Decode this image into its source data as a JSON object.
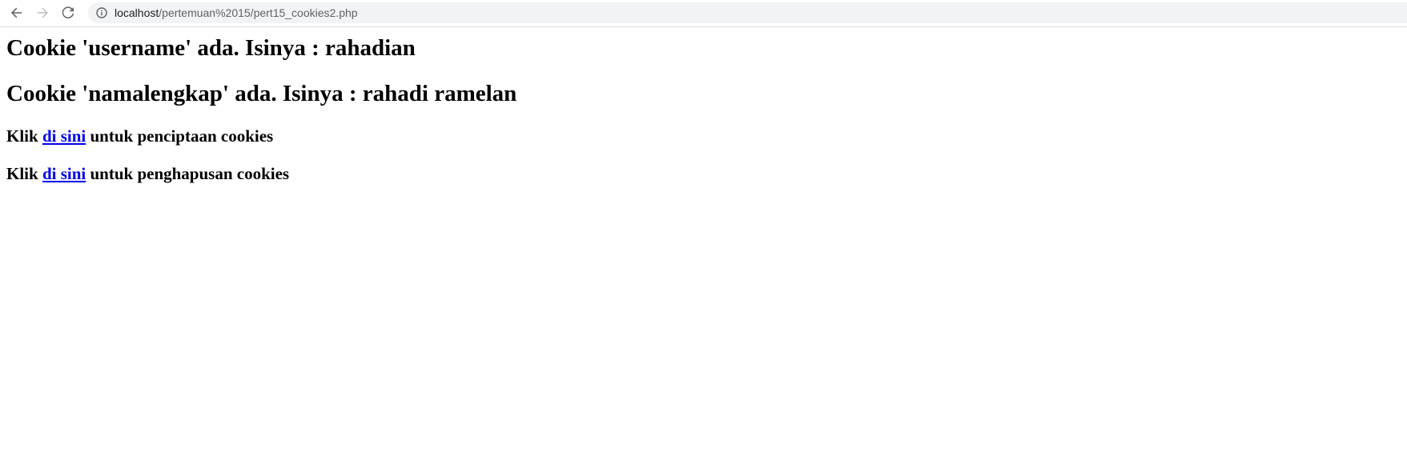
{
  "browser": {
    "url_host": "localhost",
    "url_path": "/pertemuan%2015/pert15_cookies2.php",
    "icons": {
      "back": "back-arrow-icon",
      "forward": "forward-arrow-icon",
      "reload": "reload-icon",
      "info": "info-icon"
    }
  },
  "page": {
    "heading_username": "Cookie 'username' ada. Isinya : rahadian",
    "heading_namalengkap": "Cookie 'namalengkap' ada. Isinya : rahadi ramelan",
    "create_line": {
      "prefix": "Klik ",
      "link_text": "di sini",
      "suffix": " untuk penciptaan cookies"
    },
    "delete_line": {
      "prefix": "Klik ",
      "link_text": "di sini",
      "suffix": " untuk penghapusan cookies"
    }
  },
  "colors": {
    "link": "#0000ee",
    "omnibox_bg": "#f1f3f4",
    "icon": "#5f6368",
    "icon_disabled": "#bdc1c6"
  }
}
